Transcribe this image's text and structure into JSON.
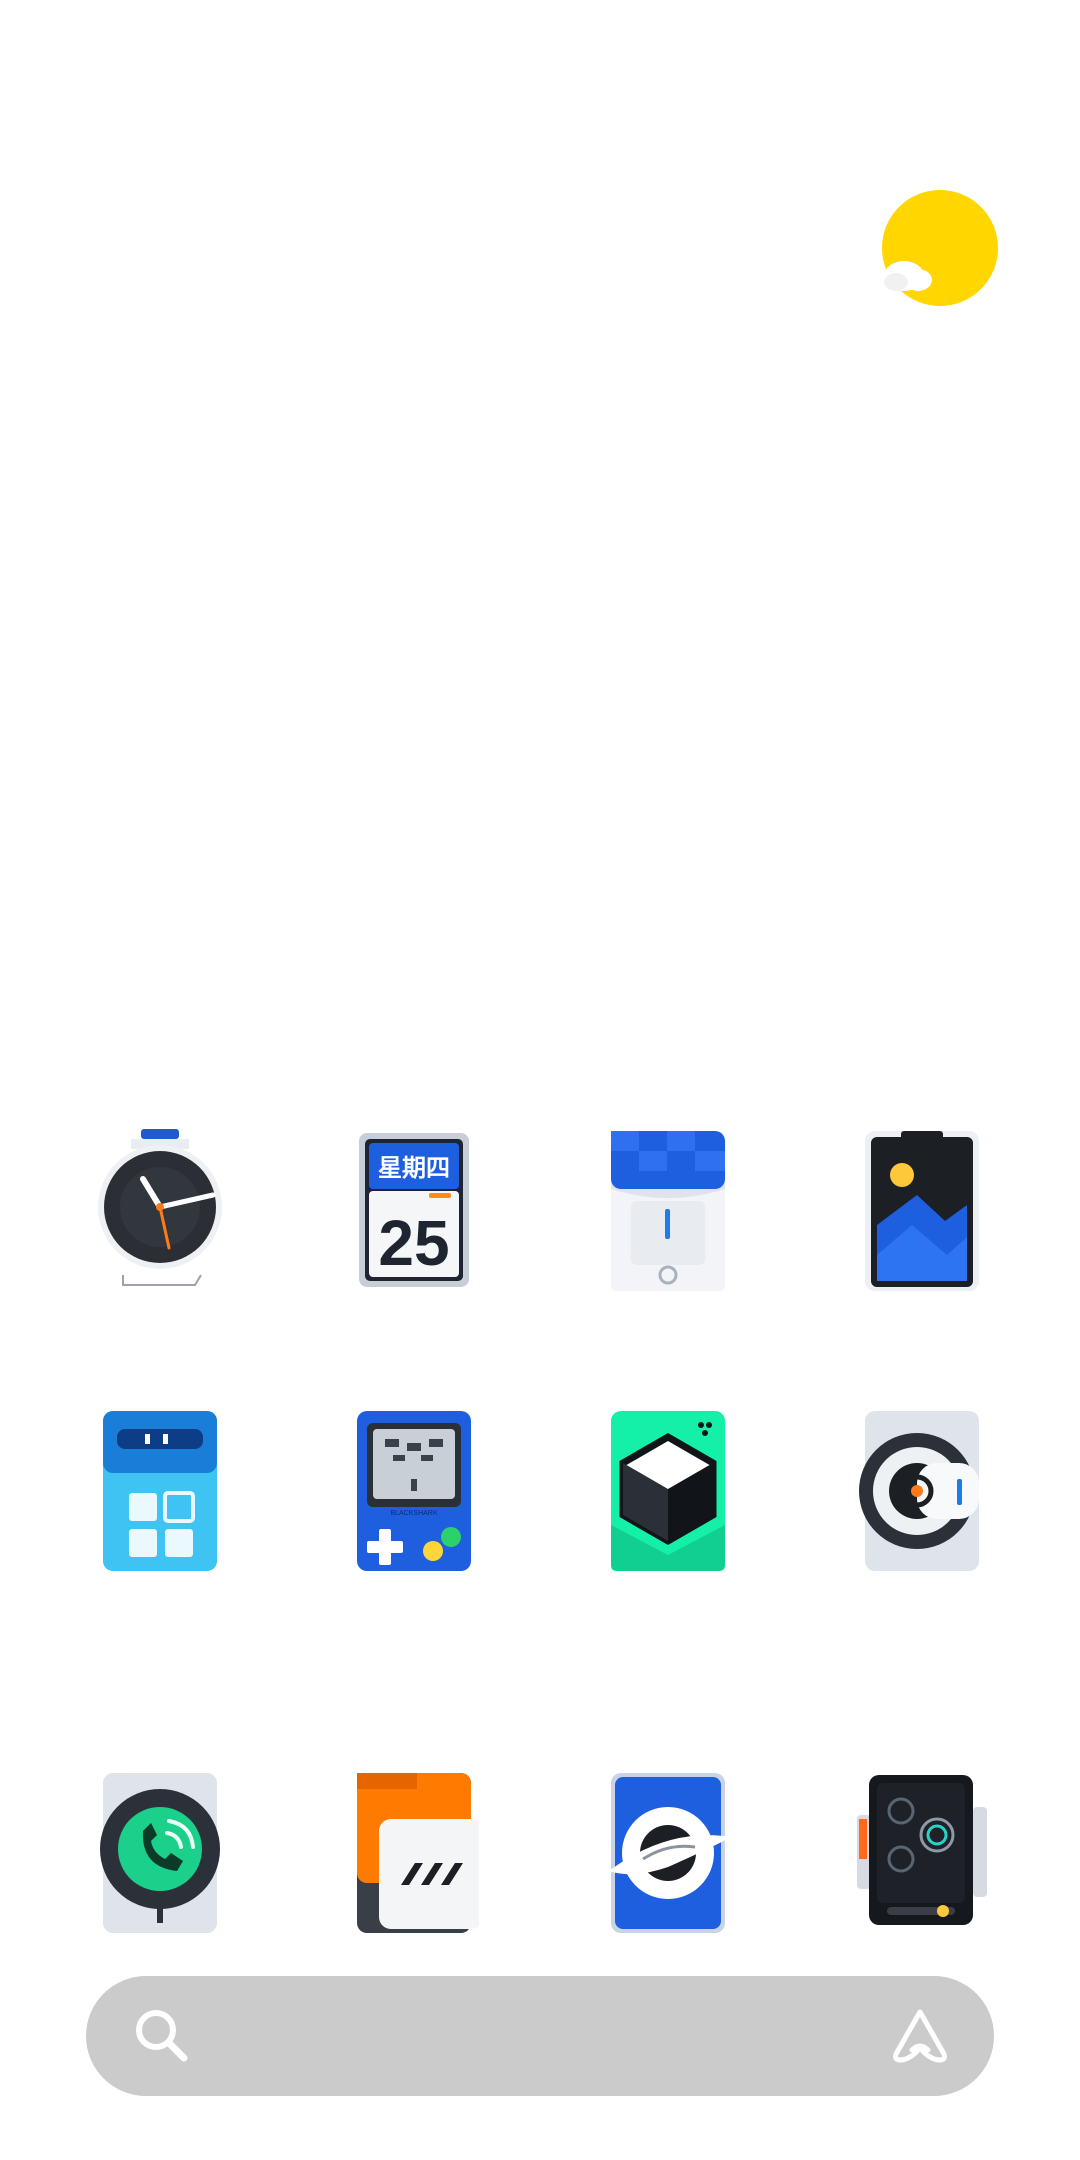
{
  "weather": {
    "icon": "sunny-icon"
  },
  "apps": [
    {
      "name": "clock",
      "icon": "clock-icon"
    },
    {
      "name": "calendar",
      "icon": "calendar-icon",
      "weekday": "星期四",
      "day": "25"
    },
    {
      "name": "file-manager",
      "icon": "file-manager-icon"
    },
    {
      "name": "gallery",
      "icon": "gallery-icon"
    },
    {
      "name": "tools",
      "icon": "tools-icon"
    },
    {
      "name": "game-space",
      "icon": "gamepad-icon",
      "brand": "BLACKSHARK"
    },
    {
      "name": "3d-app",
      "icon": "cube-icon"
    },
    {
      "name": "settings",
      "icon": "gear-icon"
    },
    {
      "name": "phone",
      "icon": "phone-icon"
    },
    {
      "name": "messages",
      "icon": "message-icon"
    },
    {
      "name": "browser",
      "icon": "browser-icon"
    },
    {
      "name": "camera",
      "icon": "camera-icon"
    }
  ],
  "search": {
    "icon": "search-icon",
    "assistant_icon": "assistant-icon"
  },
  "colors": {
    "search_bg": "#cbcbcb",
    "accent_blue": "#1e5fe0",
    "sun": "#ffd600",
    "green": "#15f0a8"
  }
}
